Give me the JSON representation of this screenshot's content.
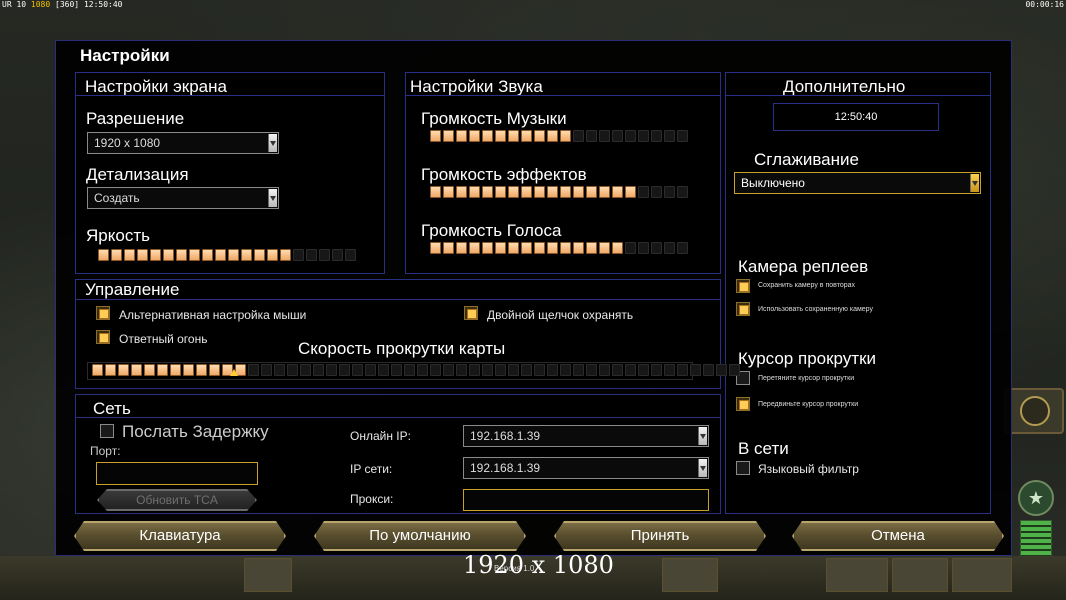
{
  "topbar": {
    "left_prefix": "UR 10",
    "left_res": "1080",
    "left_extra": "[360]",
    "left_time": "12:50:40",
    "right_time": "00:00:16"
  },
  "dialog": {
    "title": "Настройки"
  },
  "screen": {
    "title": "Настройки экрана",
    "resolution_label": "Разрешение",
    "resolution_value": "1920 x 1080",
    "detail_label": "Детализация",
    "detail_value": "Создать",
    "brightness_label": "Яркость",
    "brightness_level": 0.75
  },
  "sound": {
    "title": "Настройки Звука",
    "music_label": "Громкость Музыки",
    "music_level": 0.55,
    "effects_label": "Громкость эффектов",
    "effects_level": 0.8,
    "voice_label": "Громкость Голоса",
    "voice_level": 0.75
  },
  "extra": {
    "title": "Дополнительно",
    "clock": "12:50:40",
    "aa_label": "Сглаживание",
    "aa_value": "Выключено",
    "replay_camera_title": "Камера реплеев",
    "replay_save_label": "Сохранить камеру в повторах",
    "replay_use_label": "Использовать сохраненную камеру",
    "scroll_cursor_title": "Курсор прокрутки",
    "scroll_cursor_opt1": "Перетяните курсор прокрутки",
    "scroll_cursor_opt2": "Передвиньте курсор прокрутки",
    "online_title": "В сети",
    "lang_filter_label": "Языковый фильтр"
  },
  "control": {
    "title": "Управление",
    "alt_mouse_label": "Альтернативная настройка мыши",
    "double_click_label": "Двойной щелчок охранять",
    "return_fire_label": "Ответный огонь",
    "scroll_speed_label": "Скорость прокрутки карты",
    "scroll_speed_level": 0.24
  },
  "network": {
    "title": "Сеть",
    "send_delay_label": "Послать Задержку",
    "port_label": "Порт:",
    "update_tca_label": "Обновить TCA",
    "online_ip_label": "Онлайн IP:",
    "online_ip_value": "192.168.1.39",
    "lan_ip_label": "IP сети:",
    "lan_ip_value": "192.168.1.39",
    "proxy_label": "Прокси:"
  },
  "buttons": {
    "keyboard": "Клавиатура",
    "defaults": "По умолчанию",
    "accept": "Принять",
    "cancel": "Отмена"
  },
  "overlay": {
    "resolution": "1920 x 1080",
    "version": "Версия 1.0"
  }
}
